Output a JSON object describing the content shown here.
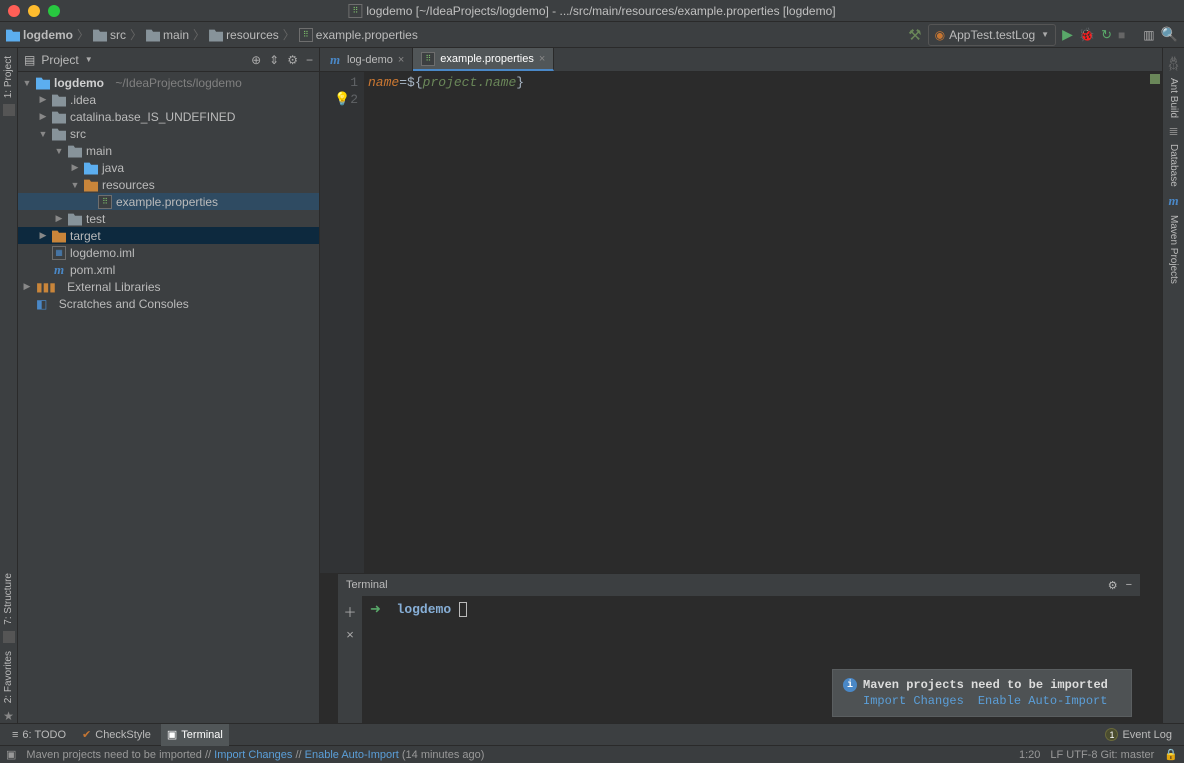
{
  "titlebar": {
    "title": "logdemo [~/IdeaProjects/logdemo] - .../src/main/resources/example.properties [logdemo]"
  },
  "breadcrumb": [
    "logdemo",
    "src",
    "main",
    "resources",
    "example.properties"
  ],
  "runconfig": {
    "label": "AppTest.testLog"
  },
  "left_tabs": [
    "1: Project"
  ],
  "right_tabs": [
    "Ant Build",
    "Database",
    "Maven Projects"
  ],
  "project": {
    "title": "Project",
    "tree": {
      "root": {
        "name": "logdemo",
        "path": "~/IdeaProjects/logdemo"
      },
      "nodes": [
        ".idea",
        "catalina.base_IS_UNDEFINED",
        "src",
        "main",
        "java",
        "resources",
        "example.properties",
        "test",
        "target",
        "logdemo.iml",
        "pom.xml",
        "External Libraries",
        "Scratches and Consoles"
      ]
    }
  },
  "tabs": [
    {
      "name": "log-demo",
      "active": false,
      "type": "maven"
    },
    {
      "name": "example.properties",
      "active": true,
      "type": "prop"
    }
  ],
  "code": {
    "lines": [
      "1",
      "2"
    ],
    "content_key": "name",
    "eq": "=",
    "open": "${",
    "var": "project.name",
    "close": "}"
  },
  "terminal": {
    "title": "Terminal",
    "prompt_arrow": "➜",
    "cwd": "logdemo"
  },
  "notification": {
    "title": "Maven projects need to be imported",
    "link1": "Import Changes",
    "link2": "Enable Auto-Import"
  },
  "bottombar": {
    "todo": "6: TODO",
    "checkstyle": "CheckStyle",
    "terminal": "Terminal",
    "eventlog": "Event Log",
    "eventcount": "1"
  },
  "status": {
    "msg1": "Maven projects need to be imported",
    "msg2": "Import Changes",
    "msg3": "Enable Auto-Import",
    "msg_time": "(14 minutes ago)",
    "pos": "1:20",
    "enc": "LF  UTF-8  Git: master"
  }
}
